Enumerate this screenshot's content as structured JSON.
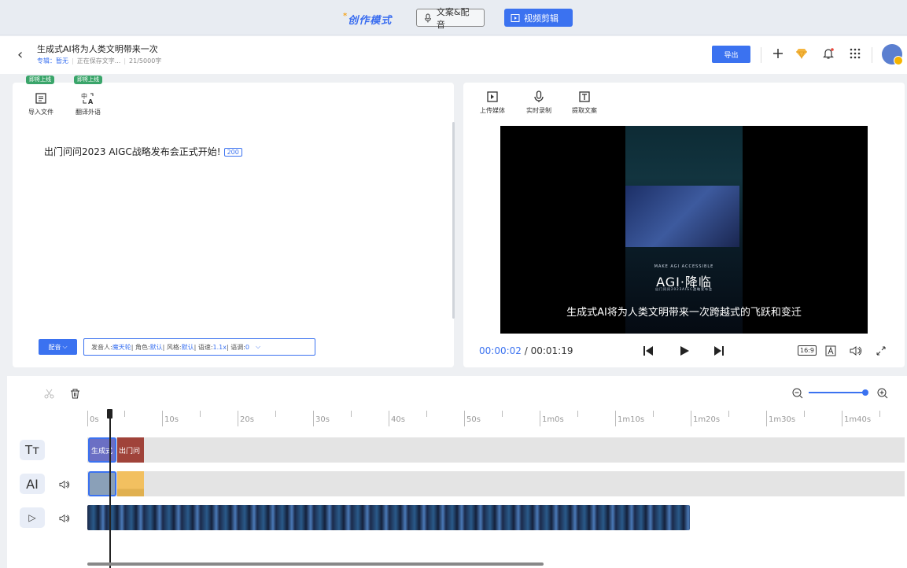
{
  "top": {
    "brand": "创作模式",
    "tabs": [
      "文案&配音",
      "视频剪辑"
    ]
  },
  "header": {
    "title": "生成式AI将为人类文明带来一次",
    "album_label": "专辑：",
    "album_value": "暂无",
    "saving": "正在保存文字...",
    "word_count": "21/5000字",
    "export": "导出"
  },
  "left": {
    "badges": [
      "即将上线",
      "即将上线"
    ],
    "tools": [
      "导入文件",
      "翻译外语"
    ],
    "text": "出门问问2023 AIGC战略发布会正式开始!",
    "text_count": "200",
    "dub_button": "配音",
    "voice": {
      "speaker_label": "发音人: ",
      "speaker": "魔天轮",
      "role_label": " | 角色: ",
      "role": "默认",
      "style_label": " | 风格: ",
      "style": "默认",
      "speed_label": " | 语速: ",
      "speed": "1.1x",
      "pitch_label": " | 语调: ",
      "pitch": "0"
    }
  },
  "right": {
    "tools": [
      "上传媒体",
      "实时录制",
      "提取文案"
    ],
    "video_small": "MAKE AGI ACCESSIBLE",
    "video_title": "AGI·降临",
    "video_caption": "出门问问2023AIGC战略发布会",
    "subtitle": "生成式AI将为人类文明带来一次跨越式的飞跃和变迁",
    "current_time": "00:00:02",
    "separator": " / ",
    "total_time": "00:01:19",
    "aspect": "16:9"
  },
  "timeline": {
    "ruler": [
      "0s",
      "10s",
      "20s",
      "30s",
      "40s",
      "50s",
      "1m0s",
      "1m10s",
      "1m20s",
      "1m30s",
      "1m40s"
    ],
    "tracks": [
      "Tт",
      "AI",
      "▷"
    ],
    "text_clips": [
      "生成式",
      "出门问"
    ]
  }
}
